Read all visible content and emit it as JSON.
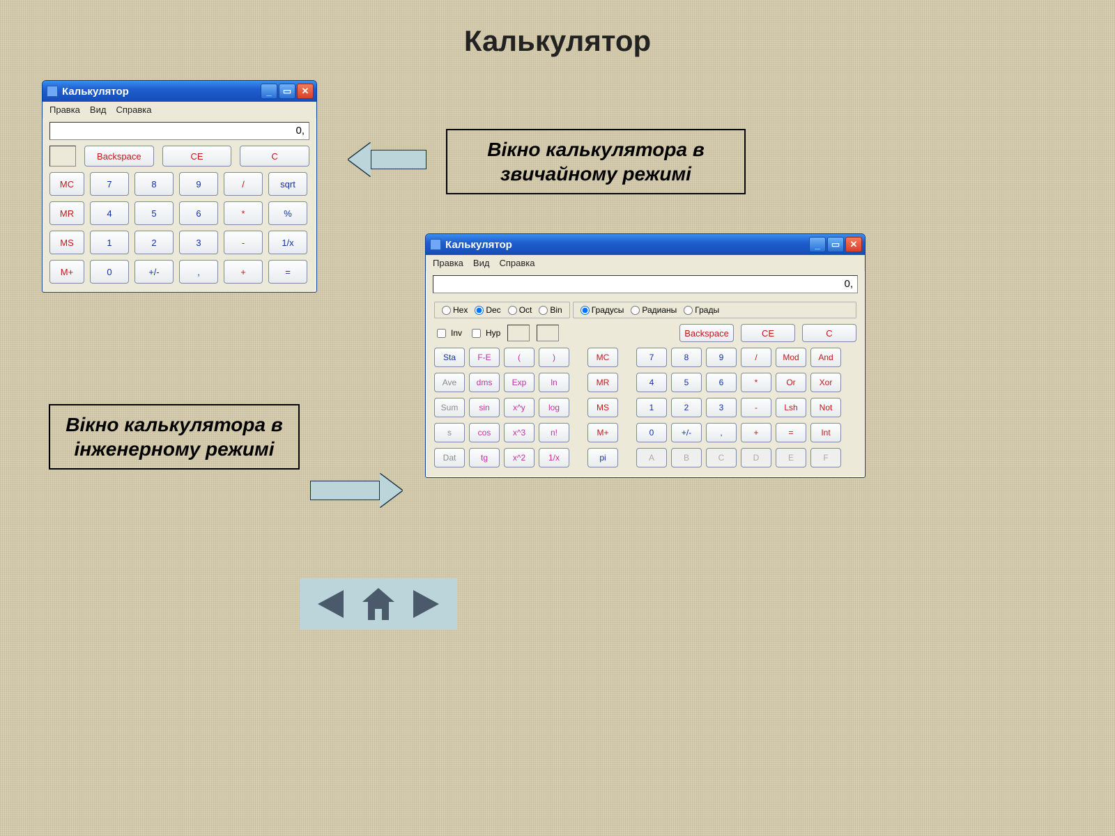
{
  "page_title": "Калькулятор",
  "labels": {
    "standard": "Вікно калькулятора в звичайному режимі",
    "scientific": "Вікно калькулятора в інженерному режимі"
  },
  "calc_common": {
    "title": "Калькулятор",
    "menu": {
      "edit": "Правка",
      "view": "Вид",
      "help": "Справка"
    },
    "display_value": "0,"
  },
  "calc1": {
    "edit_keys": {
      "back": "Backspace",
      "ce": "CE",
      "c": "C"
    },
    "rows": [
      [
        "MC",
        "7",
        "8",
        "9",
        "/",
        "sqrt"
      ],
      [
        "MR",
        "4",
        "5",
        "6",
        "*",
        "%"
      ],
      [
        "MS",
        "1",
        "2",
        "3",
        "-",
        "1/x"
      ],
      [
        "M+",
        "0",
        "+/-",
        ",",
        "+",
        "="
      ]
    ]
  },
  "calc2": {
    "base": {
      "hex": "Hex",
      "dec": "Dec",
      "oct": "Oct",
      "bin": "Bin",
      "selected": "dec"
    },
    "angle": {
      "deg": "Градусы",
      "rad": "Радианы",
      "grad": "Грады",
      "selected": "deg"
    },
    "flags": {
      "inv": "Inv",
      "hyp": "Hyp"
    },
    "edit_keys": {
      "back": "Backspace",
      "ce": "CE",
      "c": "C"
    },
    "rows": [
      [
        "Sta",
        "F-E",
        "(",
        ")",
        "MC",
        "7",
        "8",
        "9",
        "/",
        "Mod",
        "And"
      ],
      [
        "Ave",
        "dms",
        "Exp",
        "ln",
        "MR",
        "4",
        "5",
        "6",
        "*",
        "Or",
        "Xor"
      ],
      [
        "Sum",
        "sin",
        "x^y",
        "log",
        "MS",
        "1",
        "2",
        "3",
        "-",
        "Lsh",
        "Not"
      ],
      [
        "s",
        "cos",
        "x^3",
        "n!",
        "M+",
        "0",
        "+/-",
        ",",
        "+",
        "=",
        "Int"
      ],
      [
        "Dat",
        "tg",
        "x^2",
        "1/x",
        "pi",
        "A",
        "B",
        "C",
        "D",
        "E",
        "F"
      ]
    ]
  }
}
